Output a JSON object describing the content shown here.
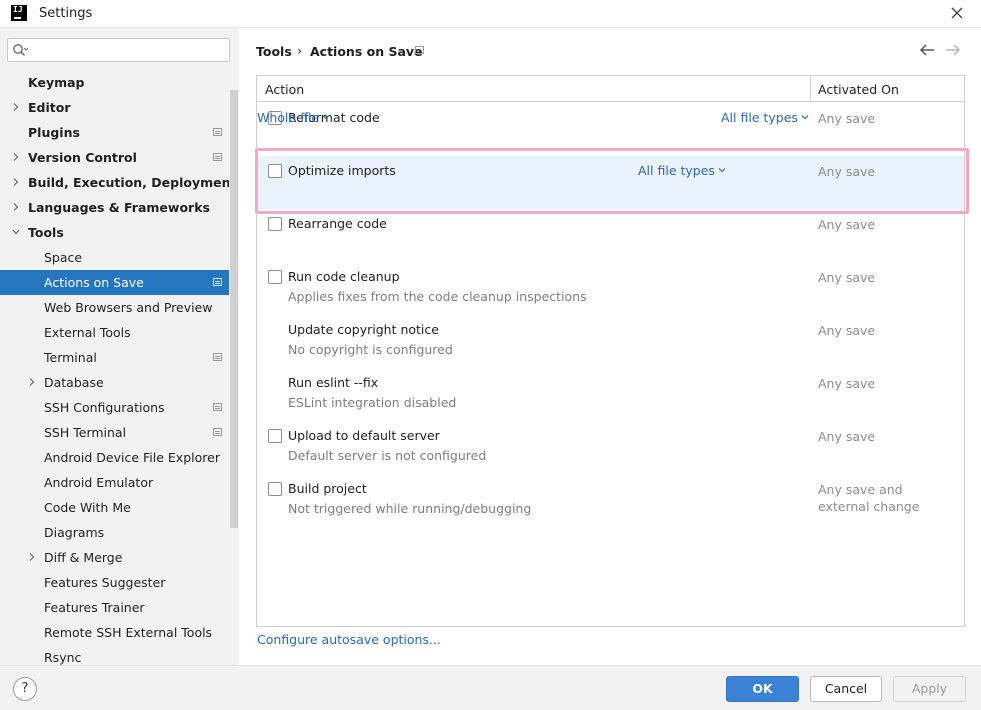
{
  "window": {
    "title": "Settings",
    "logo_text": "IJ"
  },
  "sidebar": {
    "search": {
      "value": "",
      "placeholder": ""
    },
    "items": [
      {
        "label": "Keymap",
        "bold": true,
        "indent": 0,
        "expander": "none",
        "project_icon": false,
        "selected": false
      },
      {
        "label": "Editor",
        "bold": true,
        "indent": 0,
        "expander": "collapsed",
        "project_icon": false,
        "selected": false
      },
      {
        "label": "Plugins",
        "bold": true,
        "indent": 0,
        "expander": "none",
        "project_icon": true,
        "selected": false
      },
      {
        "label": "Version Control",
        "bold": true,
        "indent": 0,
        "expander": "collapsed",
        "project_icon": true,
        "selected": false
      },
      {
        "label": "Build, Execution, Deployment",
        "bold": true,
        "indent": 0,
        "expander": "collapsed",
        "project_icon": false,
        "selected": false
      },
      {
        "label": "Languages & Frameworks",
        "bold": true,
        "indent": 0,
        "expander": "collapsed",
        "project_icon": false,
        "selected": false
      },
      {
        "label": "Tools",
        "bold": true,
        "indent": 0,
        "expander": "expanded",
        "project_icon": false,
        "selected": false
      },
      {
        "label": "Space",
        "bold": false,
        "indent": 1,
        "expander": "none",
        "project_icon": false,
        "selected": false
      },
      {
        "label": "Actions on Save",
        "bold": false,
        "indent": 1,
        "expander": "none",
        "project_icon": true,
        "selected": true
      },
      {
        "label": "Web Browsers and Preview",
        "bold": false,
        "indent": 1,
        "expander": "none",
        "project_icon": false,
        "selected": false
      },
      {
        "label": "External Tools",
        "bold": false,
        "indent": 1,
        "expander": "none",
        "project_icon": false,
        "selected": false
      },
      {
        "label": "Terminal",
        "bold": false,
        "indent": 1,
        "expander": "none",
        "project_icon": true,
        "selected": false
      },
      {
        "label": "Database",
        "bold": false,
        "indent": 1,
        "expander": "collapsed",
        "project_icon": false,
        "selected": false
      },
      {
        "label": "SSH Configurations",
        "bold": false,
        "indent": 1,
        "expander": "none",
        "project_icon": true,
        "selected": false
      },
      {
        "label": "SSH Terminal",
        "bold": false,
        "indent": 1,
        "expander": "none",
        "project_icon": true,
        "selected": false
      },
      {
        "label": "Android Device File Explorer",
        "bold": false,
        "indent": 1,
        "expander": "none",
        "project_icon": false,
        "selected": false
      },
      {
        "label": "Android Emulator",
        "bold": false,
        "indent": 1,
        "expander": "none",
        "project_icon": false,
        "selected": false
      },
      {
        "label": "Code With Me",
        "bold": false,
        "indent": 1,
        "expander": "none",
        "project_icon": false,
        "selected": false
      },
      {
        "label": "Diagrams",
        "bold": false,
        "indent": 1,
        "expander": "none",
        "project_icon": false,
        "selected": false
      },
      {
        "label": "Diff & Merge",
        "bold": false,
        "indent": 1,
        "expander": "collapsed",
        "project_icon": false,
        "selected": false
      },
      {
        "label": "Features Suggester",
        "bold": false,
        "indent": 1,
        "expander": "none",
        "project_icon": false,
        "selected": false
      },
      {
        "label": "Features Trainer",
        "bold": false,
        "indent": 1,
        "expander": "none",
        "project_icon": false,
        "selected": false
      },
      {
        "label": "Remote SSH External Tools",
        "bold": false,
        "indent": 1,
        "expander": "none",
        "project_icon": false,
        "selected": false
      },
      {
        "label": "Rsync",
        "bold": false,
        "indent": 1,
        "expander": "none",
        "project_icon": false,
        "selected": false
      }
    ]
  },
  "breadcrumb": {
    "parent": "Tools",
    "separator": "›",
    "current": "Actions on Save"
  },
  "table": {
    "columns": {
      "action": "Action",
      "activated_on": "Activated On"
    },
    "rows": [
      {
        "label": "Reformat code",
        "sublabel": "",
        "checkbox": true,
        "checked": false,
        "links": [
          "All file types",
          "Whole file"
        ],
        "activated": "Any save",
        "highlight": false
      },
      {
        "label": "Optimize imports",
        "sublabel": "",
        "checkbox": true,
        "checked": false,
        "links": [
          "All file types"
        ],
        "activated": "Any save",
        "highlight": true
      },
      {
        "label": "Rearrange code",
        "sublabel": "",
        "checkbox": true,
        "checked": false,
        "links": [],
        "activated": "Any save",
        "highlight": false
      },
      {
        "label": "Run code cleanup",
        "sublabel": "Applies fixes from the code cleanup inspections",
        "checkbox": true,
        "checked": false,
        "links": [],
        "activated": "Any save",
        "highlight": false
      },
      {
        "label": "Update copyright notice",
        "sublabel": "No copyright is configured",
        "checkbox": false,
        "checked": false,
        "links": [],
        "activated": "Any save",
        "highlight": false
      },
      {
        "label": "Run eslint --fix",
        "sublabel": "ESLint integration disabled",
        "checkbox": false,
        "checked": false,
        "links": [],
        "activated": "Any save",
        "highlight": false
      },
      {
        "label": "Upload to default server",
        "sublabel": "Default server is not configured",
        "checkbox": true,
        "checked": false,
        "links": [],
        "activated": "Any save",
        "highlight": false
      },
      {
        "label": "Build project",
        "sublabel": "Not triggered while running/debugging",
        "checkbox": true,
        "checked": false,
        "links": [],
        "activated": "Any save and\nexternal change",
        "highlight": false
      }
    ]
  },
  "autosave_link": "Configure autosave options...",
  "buttons": {
    "ok": "OK",
    "cancel": "Cancel",
    "apply": "Apply",
    "help": "?"
  },
  "colors": {
    "accent": "#2675bf",
    "link": "#2a69b3",
    "ok_button": "#3b82d4",
    "highlight_row": "#eaf2fb",
    "annotation_box": "#f2a9c6"
  }
}
